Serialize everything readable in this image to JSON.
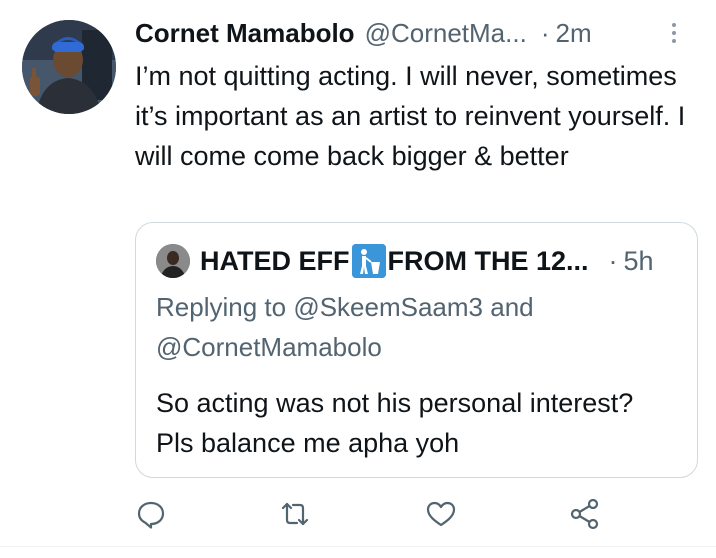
{
  "tweet": {
    "author_name": "Cornet Mamabolo",
    "author_handle": "@CornetMa...",
    "separator": "·",
    "time": "2m",
    "text": "I’m not quitting acting. I will never, sometimes it’s important as an artist to reinvent yourself. I will come come back bigger & better"
  },
  "quoted": {
    "name_start": "HATED EFF",
    "name_end": "FROM THE 12...",
    "emoji": "put-litter-in-its-place-icon",
    "separator": "·",
    "time": "5h",
    "replying_prefix": "Replying to",
    "reply_user_1": "@SkeemSaam3",
    "reply_and": "and",
    "reply_user_2": "@CornetMamabolo",
    "text": "So acting was not his personal interest? Pls balance me apha yoh"
  },
  "actions": [
    {
      "icon": "reply-icon"
    },
    {
      "icon": "retweet-icon"
    },
    {
      "icon": "like-icon"
    },
    {
      "icon": "share-icon"
    }
  ],
  "colors": {
    "text": "#0f1419",
    "secondary": "#536471",
    "border": "#cfd9de",
    "icon": "#536471"
  }
}
